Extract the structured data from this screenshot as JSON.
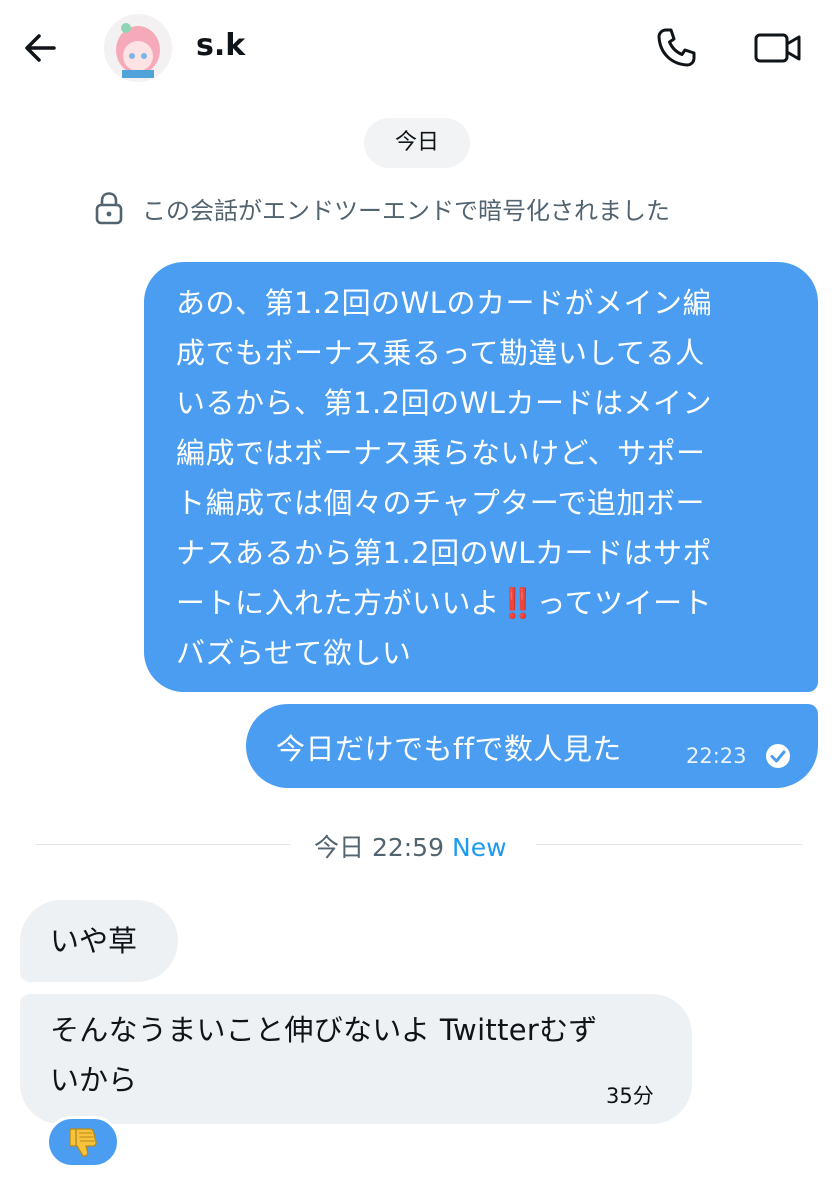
{
  "header": {
    "back_icon": "arrow-left-icon",
    "username": "s.k",
    "call_icon": "phone-icon",
    "video_icon": "video-camera-icon"
  },
  "conversation": {
    "date_pill": "今日",
    "encryption_notice": "この会話がエンドツーエンドで暗号化されました",
    "outgoing": [
      {
        "lines": [
          "あの、第1.2回のWLのカードがメイン編",
          "成でもボーナス乗るって勘違いしてる人",
          "いるから、第1.2回のWLカードはメイン",
          "編成ではボーナス乗らないけど、サポー",
          "ト編成では個々のチャプターで追加ボー",
          "ナスあるから第1.2回のWLカードはサポ",
          "ートに入れた方がいいよ",
          "‼️",
          "ってツイート",
          "バズらせて欲しい"
        ]
      },
      {
        "text": "今日だけでもffで数人見た",
        "time": "22:23",
        "status_icon": "check-circle-icon"
      }
    ],
    "new_divider": {
      "time_text": "今日 22:59",
      "new_label": "New"
    },
    "incoming": [
      {
        "text": "いや草"
      },
      {
        "line1": "そんなうまいこと伸びないよ Twitterむず",
        "line2": "いから",
        "time": "35分",
        "reaction": "👎"
      }
    ]
  },
  "colors": {
    "outgoing_bubble": "#4a9df0",
    "incoming_bubble": "#eef1f3",
    "new_accent": "#1d9bf0",
    "secondary_text": "#536471"
  }
}
